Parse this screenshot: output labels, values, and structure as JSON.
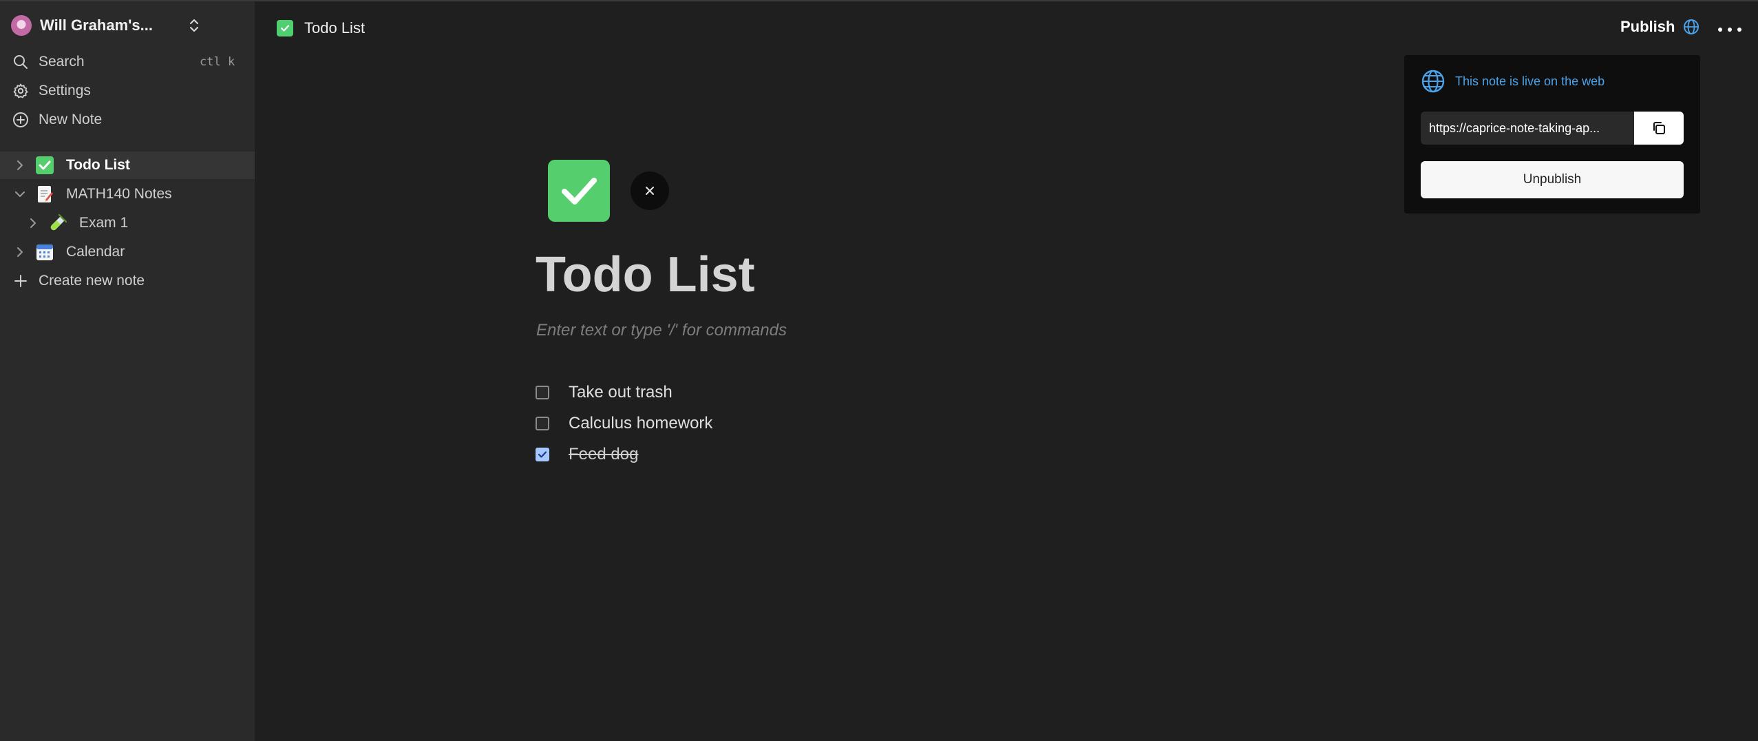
{
  "sidebar": {
    "workspace_name": "Will Graham's...",
    "search_label": "Search",
    "search_shortcut": "ctl k",
    "settings_label": "Settings",
    "new_note_label": "New Note",
    "tree": [
      {
        "label": "Todo List",
        "icon": "check-box-icon",
        "expanded": false,
        "active": true
      },
      {
        "label": "MATH140 Notes",
        "icon": "memo-icon",
        "expanded": true,
        "active": false
      },
      {
        "label": "Exam 1",
        "icon": "test-tube-icon",
        "expanded": false,
        "active": false
      },
      {
        "label": "Calendar",
        "icon": "calendar-icon",
        "expanded": false,
        "active": false
      }
    ],
    "create_new_note_label": "Create new note"
  },
  "topbar": {
    "note_title": "Todo List",
    "publish_label": "Publish"
  },
  "popover": {
    "live_text": "This note is live on the web",
    "url_value": "https://caprice-note-taking-ap...",
    "unpublish_label": "Unpublish"
  },
  "note": {
    "title": "Todo List",
    "placeholder": "Enter text or type '/' for commands",
    "todos": [
      {
        "text": "Take out trash",
        "checked": false
      },
      {
        "text": "Calculus homework",
        "checked": false
      },
      {
        "text": "Feed dog",
        "checked": true
      }
    ]
  },
  "colors": {
    "accent_green": "#55cf6e",
    "link_blue": "#4aa3ea",
    "checkbox_checked": "#a7c7ff"
  }
}
